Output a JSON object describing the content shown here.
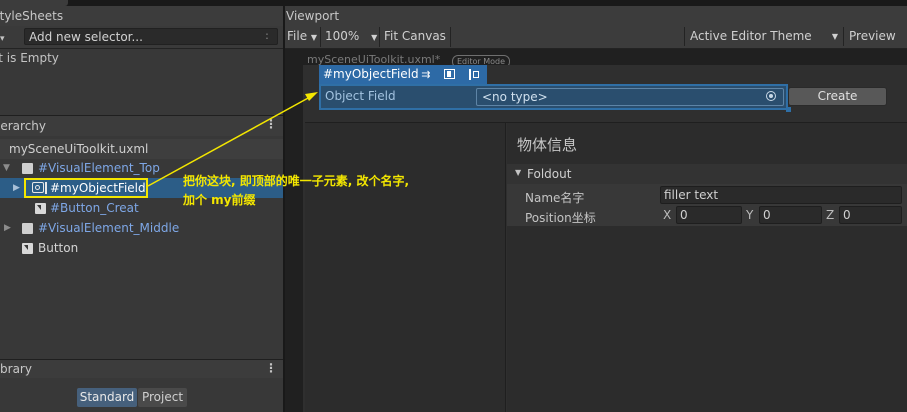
{
  "app": {
    "window_tab": "UI Builder"
  },
  "stylesheets": {
    "title": "StyleSheets",
    "add_button": "+",
    "selector_placeholder": "Add new selector...",
    "selector_menu": ":",
    "empty_text": "List is Empty"
  },
  "hierarchy": {
    "title": "Hierarchy",
    "menu": "⋮",
    "file": "mySceneUiToolkit.uxml",
    "items": [
      {
        "label": "#VisualElement_Top",
        "expanded": true
      },
      {
        "label": "#myObjectField",
        "expanded": false,
        "selected": true
      },
      {
        "label": "#Button_Creat"
      },
      {
        "label": "#VisualElement_Middle",
        "expanded": false
      },
      {
        "label": "Button"
      }
    ]
  },
  "library": {
    "title": "Library",
    "menu": "⋮",
    "tabs": [
      {
        "label": "Standard",
        "active": true
      },
      {
        "label": "Project",
        "active": false
      }
    ]
  },
  "viewport": {
    "title": "Viewport",
    "file_menu": "File",
    "zoom": "100%",
    "fit_canvas": "Fit Canvas",
    "theme": "Active Editor Theme",
    "preview": "Preview",
    "canvas_title": "mySceneUiToolkit.uxml*",
    "editor_mode": "Editor Mode"
  },
  "canvas": {
    "selection_badge": "#myObjectField",
    "object_field_label": "Object Field",
    "object_field_value": "<no type>",
    "create_button": "Create",
    "info_title": "物体信息",
    "foldout_label": "Foldout",
    "name_label": "Name名字",
    "name_value": "filler text",
    "position_label": "Position坐标",
    "x_label": "X",
    "x_value": "0",
    "y_label": "Y",
    "y_value": "0",
    "z_label": "Z",
    "z_value": "0"
  },
  "annotation": {
    "line1": "把你这块, 即顶部的唯一子元素, 改个名字,",
    "line2": "加个 my前缀",
    "color": "#f3e600"
  },
  "colors": {
    "selection_blue": "#2c5d87",
    "accent_blue": "#2d6aa6"
  }
}
